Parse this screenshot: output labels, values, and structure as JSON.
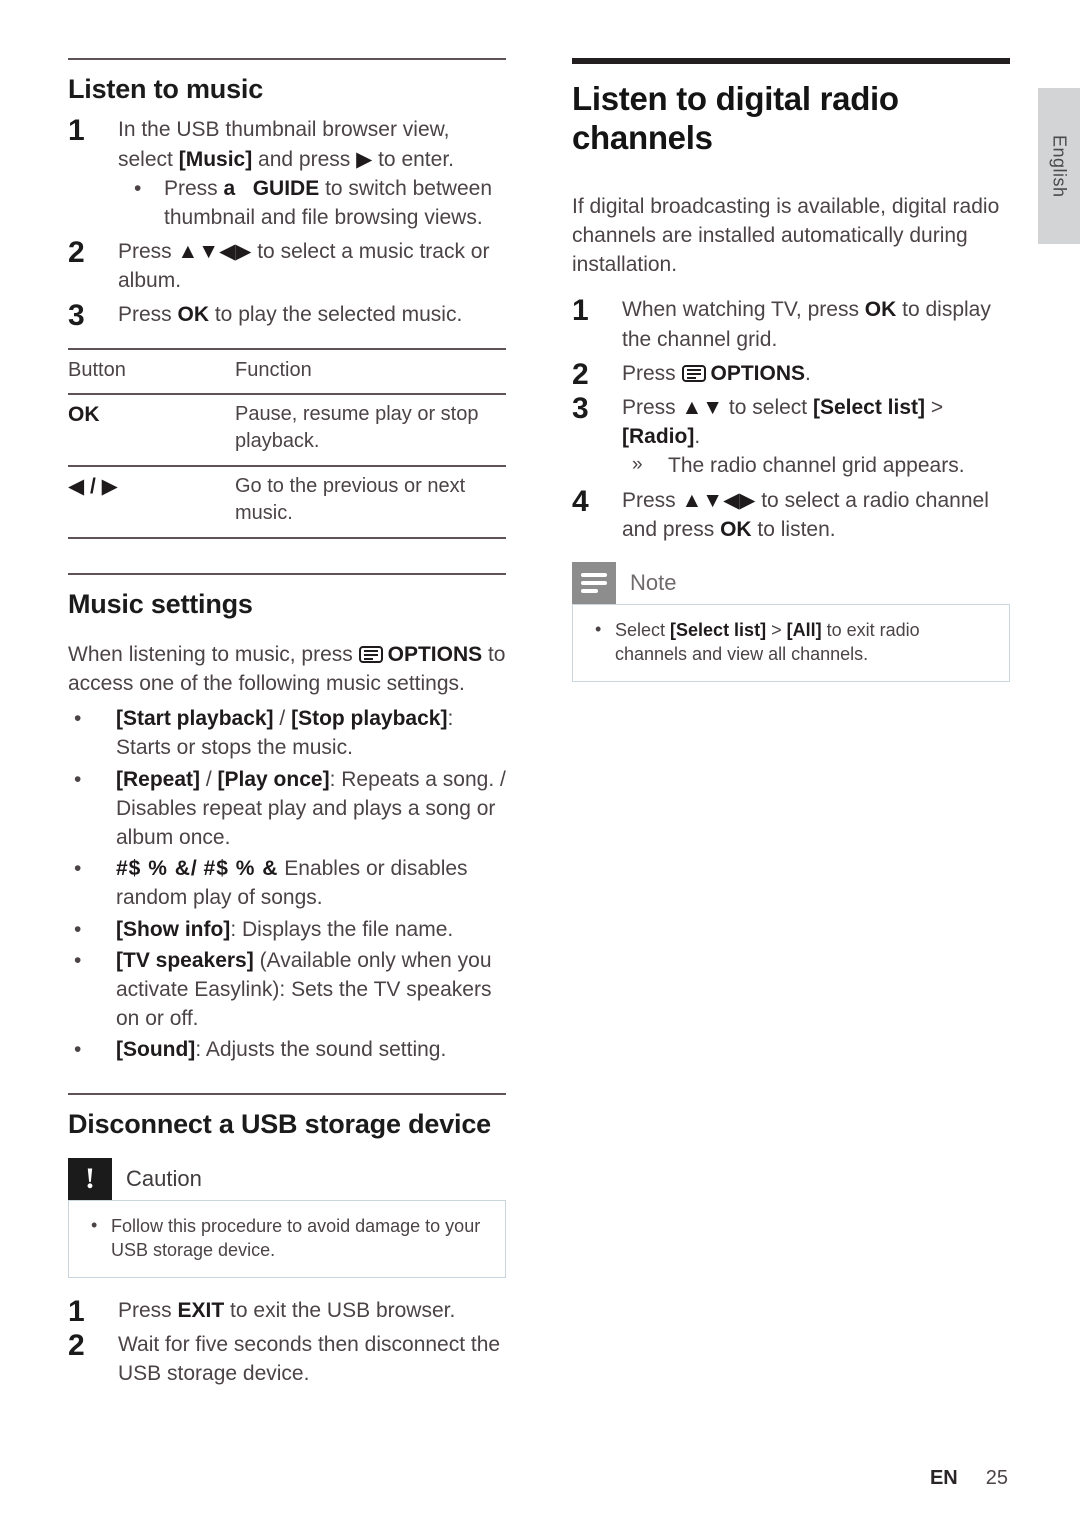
{
  "page": {
    "language_tab": "English",
    "footer": {
      "locale": "EN",
      "page_number": "25"
    }
  },
  "left_column": {
    "section_music": {
      "heading": "Listen to music",
      "steps": [
        {
          "num": "1",
          "text_before": "In the USB thumbnail browser view, select ",
          "bold1": "[Music]",
          "text_mid": " and press ",
          "glyph": "▶",
          "text_after": " to enter.",
          "substep": {
            "bullet": "•",
            "text_before": "Press ",
            "key1": "a",
            "key2": "GUIDE",
            "text_after": " to switch between thumbnail and file browsing views."
          }
        },
        {
          "num": "2",
          "text_before": "Press ",
          "glyph": "▲▼◀▶",
          "text_after": " to select a music track or album."
        },
        {
          "num": "3",
          "text_before": "Press ",
          "key": "OK",
          "text_after": " to play the selected music."
        }
      ],
      "table": {
        "headers": [
          "Button",
          "Function"
        ],
        "rows": [
          {
            "button": "OK",
            "function": "Pause, resume play or stop playback."
          },
          {
            "button": "◀ / ▶",
            "function": "Go to the previous or next music."
          }
        ]
      }
    },
    "section_music_settings": {
      "heading": "Music settings",
      "intro_before": "When listening to music, press ",
      "intro_icon": "options-icon",
      "intro_key": "OPTIONS",
      "intro_after": " to access one of the following music settings.",
      "bullets": [
        {
          "bullet": "•",
          "bold1": "[Start playback]",
          "sep": " / ",
          "bold2": "[Stop playback]",
          "rest": ": Starts or stops the music."
        },
        {
          "bullet": "•",
          "bold1": "[Repeat]",
          "sep": " / ",
          "bold2": "[Play once]",
          "rest": ": Repeats a song. / Disables repeat play and plays a song or album once."
        },
        {
          "bullet": "•",
          "bold1": "#$   %     &/",
          "sep": " ",
          "bold2": "#$   %      &",
          "rest": " Enables or disables random play of songs."
        },
        {
          "bullet": "•",
          "bold1": "[Show info]",
          "sep": "",
          "bold2": "",
          "rest": ": Displays the file name."
        },
        {
          "bullet": "•",
          "bold1": "[TV speakers]",
          "sep": "",
          "bold2": "",
          "rest": " (Available only when you activate Easylink): Sets the TV speakers on or off."
        },
        {
          "bullet": "•",
          "bold1": "[Sound]",
          "sep": "",
          "bold2": "",
          "rest": ": Adjusts the sound setting."
        }
      ]
    },
    "section_disconnect": {
      "heading": "Disconnect a USB storage device",
      "caution": {
        "title": "Caution",
        "badge_glyph": "!",
        "bullet": "•",
        "text": "Follow this procedure to avoid damage to your USB storage device."
      },
      "steps": [
        {
          "num": "1",
          "text_before": "Press ",
          "key": "EXIT",
          "text_after": " to exit the USB browser."
        },
        {
          "num": "2",
          "text_before": "Wait for five seconds then disconnect the USB storage device.",
          "key": "",
          "text_after": ""
        }
      ]
    }
  },
  "right_column": {
    "section_radio": {
      "heading": "Listen to digital radio channels",
      "intro": "If digital broadcasting is available, digital radio channels are installed automatically during installation.",
      "steps": [
        {
          "num": "1",
          "text_before": "When watching TV, press ",
          "key": "OK",
          "text_after": " to display the channel grid."
        },
        {
          "num": "2",
          "text_before": "Press ",
          "icon": "options-icon",
          "key": "OPTIONS",
          "text_after": "."
        },
        {
          "num": "3",
          "text_before": "Press ",
          "glyph": "▲▼",
          "text_mid": " to select ",
          "bold1": "[Select list]",
          "sep": " > ",
          "bold2": "[Radio]",
          "text_after": ".",
          "substep": {
            "marker": "»",
            "text": "The radio channel grid appears."
          }
        },
        {
          "num": "4",
          "text_before": "Press ",
          "glyph": "▲▼◀▶",
          "text_mid": " to select a radio channel and press ",
          "key": "OK",
          "text_after": " to listen."
        }
      ],
      "note": {
        "title": "Note",
        "bullet": "•",
        "text_before": "Select ",
        "bold1": "[Select list]",
        "sep": " > ",
        "bold2": "[All]",
        "text_after": " to exit radio channels and view all channels."
      }
    }
  }
}
